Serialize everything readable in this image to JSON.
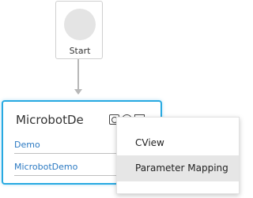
{
  "start_node": {
    "label": "Start"
  },
  "microbot_node": {
    "title": "MicrobotDe",
    "fields": [
      {
        "value": "Demo"
      },
      {
        "value": "MicrobotDemo"
      }
    ],
    "toolbar_icons": [
      "settings-icon",
      "info-icon",
      "document-icon"
    ],
    "accent_color": "#27a9e1"
  },
  "context_menu": {
    "items": [
      {
        "label": "CView"
      },
      {
        "label": "Parameter Mapping",
        "highlighted": true
      }
    ]
  }
}
